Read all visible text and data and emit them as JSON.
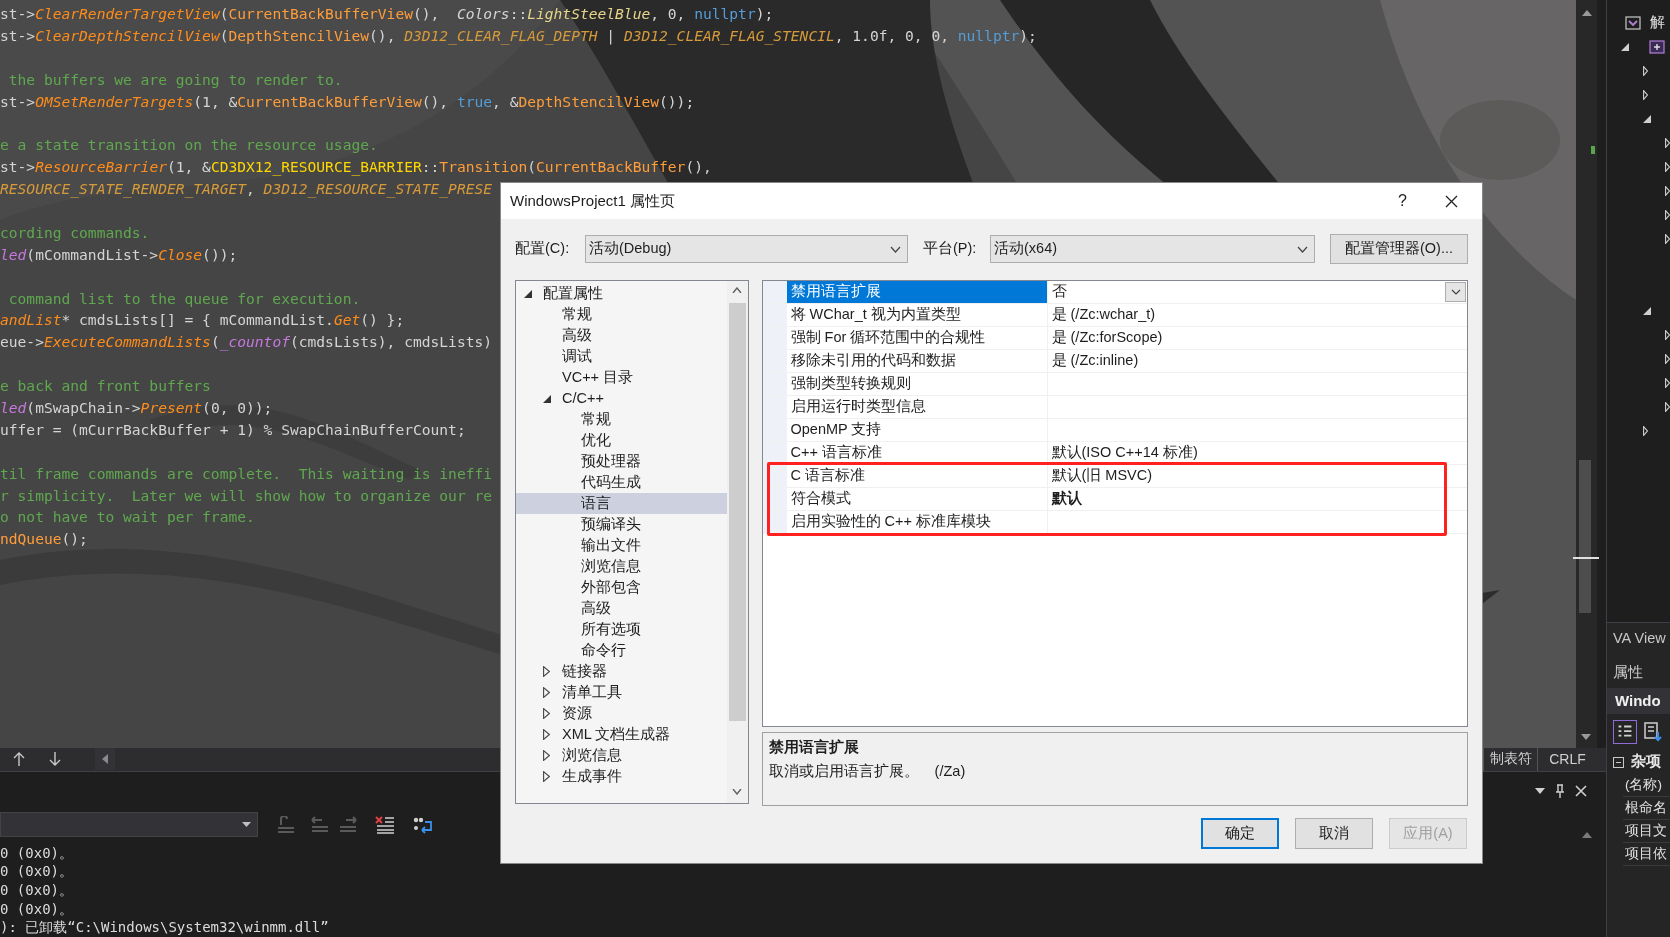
{
  "editor": {
    "code_blocks": [
      {
        "lines": [
          {
            "tokens": [
              {
                "kind": "plain",
                "text": "st->"
              },
              {
                "kind": "virtual_method",
                "text": "ClearRenderTargetView"
              },
              {
                "kind": "plain",
                "text": "("
              },
              {
                "kind": "method",
                "text": "CurrentBackBufferView"
              },
              {
                "kind": "plain",
                "text": "(),  "
              },
              {
                "kind": "namespace",
                "text": "Colors"
              },
              {
                "kind": "plain",
                "text": "::"
              },
              {
                "kind": "enum",
                "text": "LightSteelBlue"
              },
              {
                "kind": "plain",
                "text": ", 0, "
              },
              {
                "kind": "keyword",
                "text": "nullptr"
              },
              {
                "kind": "plain",
                "text": ");"
              }
            ]
          },
          {
            "tokens": [
              {
                "kind": "plain",
                "text": "st->"
              },
              {
                "kind": "virtual_method",
                "text": "ClearDepthStencilView"
              },
              {
                "kind": "plain",
                "text": "("
              },
              {
                "kind": "method",
                "text": "DepthStencilView"
              },
              {
                "kind": "plain",
                "text": "(), "
              },
              {
                "kind": "macro",
                "text": "D3D12_CLEAR_FLAG_DEPTH"
              },
              {
                "kind": "plain",
                "text": " | "
              },
              {
                "kind": "macro",
                "text": "D3D12_CLEAR_FLAG_STENCIL"
              },
              {
                "kind": "plain",
                "text": ", 1.0f, 0, 0, "
              },
              {
                "kind": "keyword",
                "text": "nullptr"
              },
              {
                "kind": "plain",
                "text": ");"
              }
            ]
          }
        ]
      },
      {
        "lines": [
          {
            "tokens": [
              {
                "kind": "comment",
                "text": " the buffers we are going to render to."
              }
            ]
          },
          {
            "tokens": [
              {
                "kind": "plain",
                "text": "st->"
              },
              {
                "kind": "virtual_method",
                "text": "OMSetRenderTargets"
              },
              {
                "kind": "plain",
                "text": "(1, &"
              },
              {
                "kind": "method",
                "text": "CurrentBackBufferView"
              },
              {
                "kind": "plain",
                "text": "(), "
              },
              {
                "kind": "keyword",
                "text": "true"
              },
              {
                "kind": "plain",
                "text": ", &"
              },
              {
                "kind": "method",
                "text": "DepthStencilView"
              },
              {
                "kind": "plain",
                "text": "());"
              }
            ]
          }
        ]
      },
      {
        "lines": [
          {
            "tokens": [
              {
                "kind": "comment",
                "text": "e a state transition on the resource usage."
              }
            ]
          },
          {
            "tokens": [
              {
                "kind": "plain",
                "text": "st->"
              },
              {
                "kind": "virtual_method",
                "text": "ResourceBarrier"
              },
              {
                "kind": "plain",
                "text": "(1, &"
              },
              {
                "kind": "type",
                "text": "CD3DX12_RESOURCE_BARRIER"
              },
              {
                "kind": "plain",
                "text": "::"
              },
              {
                "kind": "method",
                "text": "Transition"
              },
              {
                "kind": "plain",
                "text": "("
              },
              {
                "kind": "method",
                "text": "CurrentBackBuffer"
              },
              {
                "kind": "plain",
                "text": "(),"
              }
            ]
          },
          {
            "tokens": [
              {
                "kind": "macro",
                "text": "RESOURCE_STATE_RENDER_TARGET"
              },
              {
                "kind": "plain",
                "text": ", "
              },
              {
                "kind": "macro",
                "text": "D3D12_RESOURCE_STATE_PRESE"
              }
            ]
          }
        ]
      },
      {
        "lines": [
          {
            "tokens": [
              {
                "kind": "comment",
                "text": "cording commands."
              }
            ]
          },
          {
            "tokens": [
              {
                "kind": "macro_function",
                "text": "led"
              },
              {
                "kind": "plain",
                "text": "(mCommandList->"
              },
              {
                "kind": "virtual_method",
                "text": "Close"
              },
              {
                "kind": "plain",
                "text": "());"
              }
            ]
          }
        ]
      },
      {
        "lines": [
          {
            "tokens": [
              {
                "kind": "comment",
                "text": " command list to the queue for execution."
              }
            ]
          },
          {
            "tokens": [
              {
                "kind": "virtual_method",
                "text": "andList"
              },
              {
                "kind": "plain",
                "text": "* cmdsLists[] = { mCommandList."
              },
              {
                "kind": "virtual_method",
                "text": "Get"
              },
              {
                "kind": "plain",
                "text": "() };"
              }
            ]
          },
          {
            "tokens": [
              {
                "kind": "plain",
                "text": "eue->"
              },
              {
                "kind": "virtual_method",
                "text": "ExecuteCommandLists"
              },
              {
                "kind": "plain",
                "text": "("
              },
              {
                "kind": "macro_function",
                "text": "_countof"
              },
              {
                "kind": "plain",
                "text": "(cmdsLists), cmdsLists)"
              }
            ]
          }
        ]
      },
      {
        "lines": [
          {
            "tokens": [
              {
                "kind": "comment",
                "text": "e back and front buffers"
              }
            ]
          },
          {
            "tokens": [
              {
                "kind": "macro_function",
                "text": "led"
              },
              {
                "kind": "plain",
                "text": "(mSwapChain->"
              },
              {
                "kind": "virtual_method",
                "text": "Present"
              },
              {
                "kind": "plain",
                "text": "(0, 0));"
              }
            ]
          },
          {
            "tokens": [
              {
                "kind": "plain",
                "text": "uffer = (mCurrBackBuffer + 1) % SwapChainBufferCount;"
              }
            ]
          }
        ]
      },
      {
        "lines": [
          {
            "tokens": [
              {
                "kind": "comment",
                "text": "til frame commands are complete.  This waiting is ineffi"
              }
            ]
          },
          {
            "tokens": [
              {
                "kind": "comment",
                "text": "r simplicity.  Later we will show how to organize our re"
              }
            ]
          },
          {
            "tokens": [
              {
                "kind": "comment",
                "text": "o not have to wait per frame."
              }
            ]
          },
          {
            "tokens": [
              {
                "kind": "method",
                "text": "ndQueue"
              },
              {
                "kind": "plain",
                "text": "();"
              }
            ]
          }
        ]
      }
    ],
    "status": {
      "indent": "制表符",
      "line_ending": "CRLF"
    }
  },
  "output": {
    "lines": [
      "0 (0x0)。",
      "0 (0x0)。",
      "0 (0x0)。",
      "0 (0x0)。",
      "): 已卸载“C:\\Windows\\System32\\winmm.dll”"
    ]
  },
  "solution_explorer": {
    "items": [
      {
        "kind": "solution",
        "label": "解",
        "children": [
          {
            "kind": "project",
            "expanded": true,
            "children": [
              {
                "kind": "node",
                "expanded": false
              },
              {
                "kind": "node",
                "expanded": false
              },
              {
                "kind": "node",
                "expanded": true,
                "children": [
                  {
                    "kind": "node",
                    "expanded": false
                  },
                  {
                    "kind": "node",
                    "expanded": false
                  },
                  {
                    "kind": "node",
                    "expanded": false
                  },
                  {
                    "kind": "node",
                    "expanded": false
                  },
                  {
                    "kind": "node",
                    "expanded": false
                  },
                  {
                    "kind": "leaf"
                  },
                  {
                    "kind": "leaf"
                  }
                ]
              },
              {
                "kind": "node",
                "expanded": true,
                "children": [
                  {
                    "kind": "node",
                    "expanded": false
                  },
                  {
                    "kind": "node",
                    "expanded": false
                  },
                  {
                    "kind": "node",
                    "expanded": false
                  },
                  {
                    "kind": "node",
                    "expanded": false
                  }
                ]
              },
              {
                "kind": "node",
                "expanded": false
              }
            ]
          }
        ]
      }
    ]
  },
  "va_view_tab": "VA View",
  "properties_panel": {
    "title": "属性",
    "object": "Windo",
    "tools": [
      {
        "kind": "categorized",
        "selected": true
      },
      {
        "kind": "property_pages",
        "selected": false
      }
    ],
    "categories": [
      {
        "label": "杂项",
        "expanded": true,
        "rows": [
          "(名称)",
          "根命名",
          "项目文",
          "项目依"
        ]
      }
    ]
  },
  "dialog": {
    "title": "WindowsProject1 属性页",
    "help": "?",
    "configuration": {
      "label": "配置(C):",
      "value": "活动(Debug)"
    },
    "platform": {
      "label": "平台(P):",
      "value": "活动(x64)"
    },
    "manager_button": "配置管理器(O)...",
    "tree": {
      "items": [
        {
          "label": "配置属性",
          "selected": false,
          "expanded": true,
          "children": [
            {
              "label": "常规",
              "selected": false
            },
            {
              "label": "高级",
              "selected": false
            },
            {
              "label": "调试",
              "selected": false
            },
            {
              "label": "VC++ 目录",
              "selected": false
            },
            {
              "label": "C/C++",
              "selected": false,
              "expanded": true,
              "children": [
                {
                  "label": "常规",
                  "selected": false
                },
                {
                  "label": "优化",
                  "selected": false
                },
                {
                  "label": "预处理器",
                  "selected": false
                },
                {
                  "label": "代码生成",
                  "selected": false
                },
                {
                  "label": "语言",
                  "selected": true
                },
                {
                  "label": "预编译头",
                  "selected": false
                },
                {
                  "label": "输出文件",
                  "selected": false
                },
                {
                  "label": "浏览信息",
                  "selected": false
                },
                {
                  "label": "外部包含",
                  "selected": false
                },
                {
                  "label": "高级",
                  "selected": false
                },
                {
                  "label": "所有选项",
                  "selected": false
                },
                {
                  "label": "命令行",
                  "selected": false
                }
              ]
            },
            {
              "label": "链接器",
              "selected": false,
              "expanded": false
            },
            {
              "label": "清单工具",
              "selected": false,
              "expanded": false
            },
            {
              "label": "资源",
              "selected": false,
              "expanded": false
            },
            {
              "label": "XML 文档生成器",
              "selected": false,
              "expanded": false
            },
            {
              "label": "浏览信息",
              "selected": false,
              "expanded": false
            },
            {
              "label": "生成事件",
              "selected": false,
              "expanded": false
            }
          ]
        }
      ]
    },
    "grid": {
      "rows": [
        {
          "name": "禁用语言扩展",
          "value": "否",
          "selected": true,
          "modified": false
        },
        {
          "name": "将 WChar_t 视为内置类型",
          "value": "是 (/Zc:wchar_t)",
          "selected": false,
          "modified": false
        },
        {
          "name": "强制 For 循环范围中的合规性",
          "value": "是 (/Zc:forScope)",
          "selected": false,
          "modified": false
        },
        {
          "name": "移除未引用的代码和数据",
          "value": "是 (/Zc:inline)",
          "selected": false,
          "modified": false
        },
        {
          "name": "强制类型转换规则",
          "selected": false
        },
        {
          "name": "启用运行时类型信息",
          "selected": false
        },
        {
          "name": "OpenMP 支持",
          "selected": false
        },
        {
          "name": "C++ 语言标准",
          "value": "默认(ISO C++14 标准)",
          "selected": false,
          "modified": false
        },
        {
          "name": "C 语言标准",
          "value": "默认(旧 MSVC)",
          "selected": false,
          "modified": false
        },
        {
          "name": "符合模式",
          "value": "默认",
          "selected": false,
          "modified": true
        },
        {
          "name": "启用实验性的 C++ 标准库模块",
          "selected": false
        }
      ]
    },
    "description": {
      "title": "禁用语言扩展",
      "text": "取消或启用语言扩展。    (/Za)"
    },
    "buttons": [
      {
        "label": "确定",
        "default": true,
        "disabled": false
      },
      {
        "label": "取消",
        "default": false,
        "disabled": false
      },
      {
        "label": "应用(A)",
        "default": false,
        "disabled": true
      }
    ]
  }
}
